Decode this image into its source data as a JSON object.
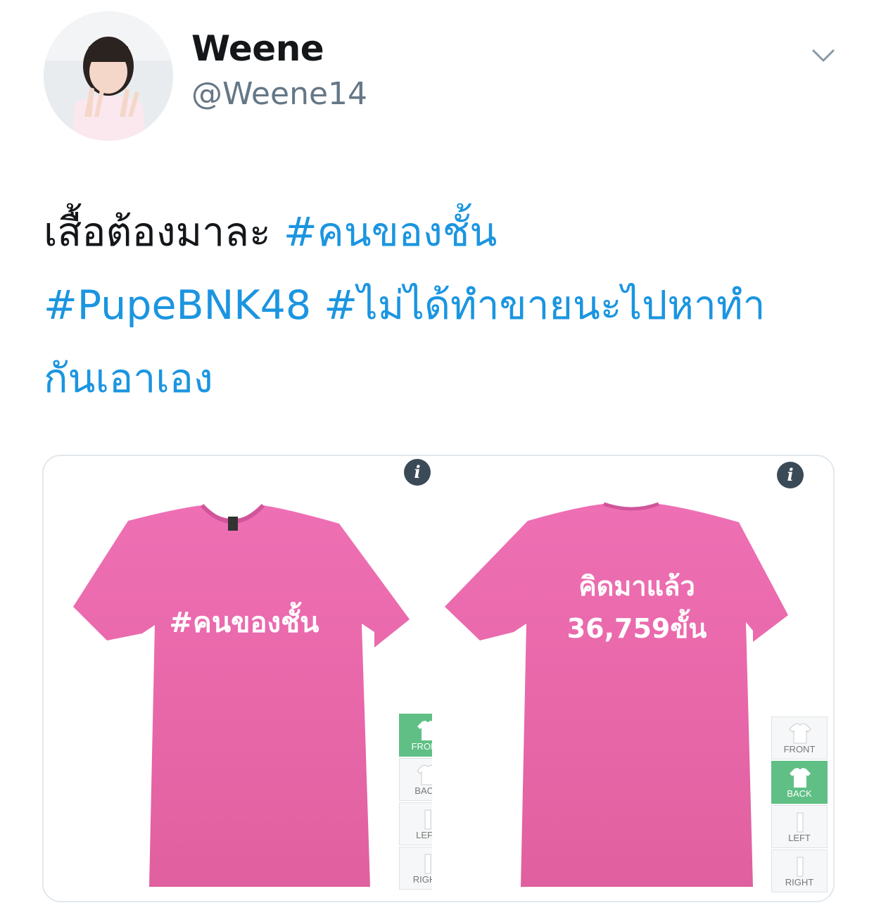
{
  "user": {
    "display_name": "Weene",
    "handle": "@Weene14"
  },
  "tweet": {
    "text_plain": "เสื้อต้องมาละ ",
    "hashtags": [
      "#คนของชั้น",
      "#PupeBNK48",
      "#ไม่ได้ทำขายนะไปหาทำกันเอาเอง"
    ]
  },
  "media": {
    "front": {
      "shirt_text": "#คนของชั้น",
      "views": [
        "FRONT",
        "BACK",
        "LEFT",
        "RIGHT"
      ],
      "active_view": "FRONT"
    },
    "back": {
      "shirt_text_line1": "คิดมาแล้ว",
      "shirt_text_line2": "36,759ขั้น",
      "views": [
        "FRONT",
        "BACK",
        "LEFT",
        "RIGHT"
      ],
      "active_view": "BACK"
    }
  },
  "colors": {
    "hashtag": "#1b95e0",
    "shirt": "#e462a8",
    "active_view": "#5fbf85"
  },
  "icons": {
    "menu": "chevron-down-icon",
    "info": "info-icon"
  }
}
